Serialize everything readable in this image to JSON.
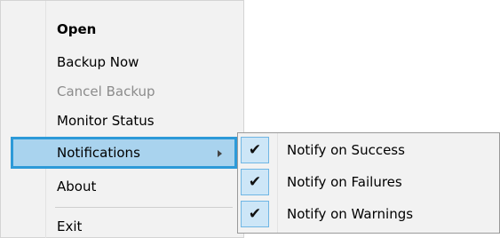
{
  "menu": {
    "items": [
      {
        "label": "Open"
      },
      {
        "label": "Backup Now"
      },
      {
        "label": "Cancel Backup"
      },
      {
        "label": "Monitor Status"
      },
      {
        "label": "Notifications"
      },
      {
        "label": "About"
      },
      {
        "label": "Exit"
      }
    ]
  },
  "submenu": {
    "items": [
      {
        "label": "Notify on Success",
        "check": "✔"
      },
      {
        "label": "Notify on Failures",
        "check": "✔"
      },
      {
        "label": "Notify on Warnings",
        "check": "✔"
      }
    ]
  },
  "colors": {
    "highlight_fill": "#a9d3ee",
    "highlight_border": "#2d9ad8",
    "menu_background": "#f2f2f2",
    "disabled_text": "#8c8c8c"
  }
}
